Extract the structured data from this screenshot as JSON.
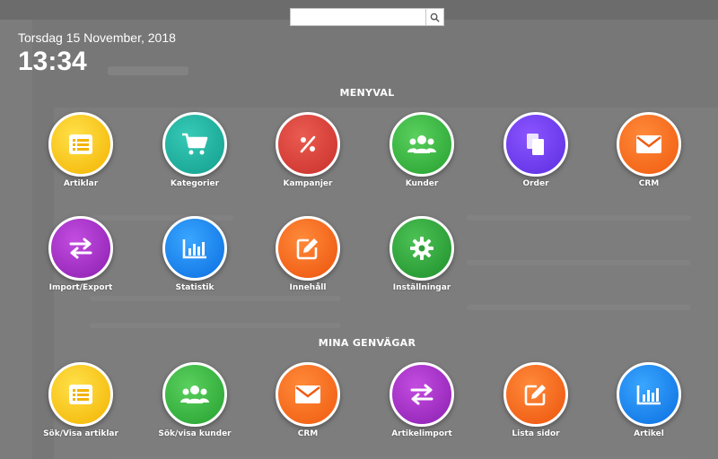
{
  "search": {
    "placeholder": "",
    "button_icon": "search-icon"
  },
  "clock": {
    "date": "Torsdag 15 November, 2018",
    "time": "13:34"
  },
  "menu": {
    "title": "MENYVAL",
    "items": [
      {
        "label": "Artiklar",
        "icon": "list-icon",
        "color": "#f5c000"
      },
      {
        "label": "Kategorier",
        "icon": "cart-icon",
        "color": "#1ab09d"
      },
      {
        "label": "Kampanjer",
        "icon": "percent-icon",
        "color": "#d23a33"
      },
      {
        "label": "Kunder",
        "icon": "users-icon",
        "color": "#2fb33a"
      },
      {
        "label": "Order",
        "icon": "copy-icon",
        "color": "#6a38f0"
      },
      {
        "label": "CRM",
        "icon": "envelope-icon",
        "color": "#f36a1a"
      },
      {
        "label": "Import/Export",
        "icon": "exchange-icon",
        "color": "#9d2ec8"
      },
      {
        "label": "Statistik",
        "icon": "chart-icon",
        "color": "#1481ee"
      },
      {
        "label": "Innehåll",
        "icon": "edit-icon",
        "color": "#f36a1a"
      },
      {
        "label": "Inställningar",
        "icon": "gear-icon",
        "color": "#2e9e38"
      }
    ]
  },
  "shortcuts": {
    "title": "MINA GENVÄGAR",
    "items": [
      {
        "label": "Sök/Visa artiklar",
        "icon": "list-icon",
        "color": "#f5c000"
      },
      {
        "label": "Sök/visa kunder",
        "icon": "users-icon",
        "color": "#2fb33a"
      },
      {
        "label": "CRM",
        "icon": "envelope-icon",
        "color": "#f36a1a"
      },
      {
        "label": "Artikelimport",
        "icon": "exchange-icon",
        "color": "#9d2ec8"
      },
      {
        "label": "Lista sidor",
        "icon": "edit-icon",
        "color": "#f36a1a"
      },
      {
        "label": "Artikel",
        "icon": "chart-icon",
        "color": "#1481ee"
      }
    ]
  }
}
